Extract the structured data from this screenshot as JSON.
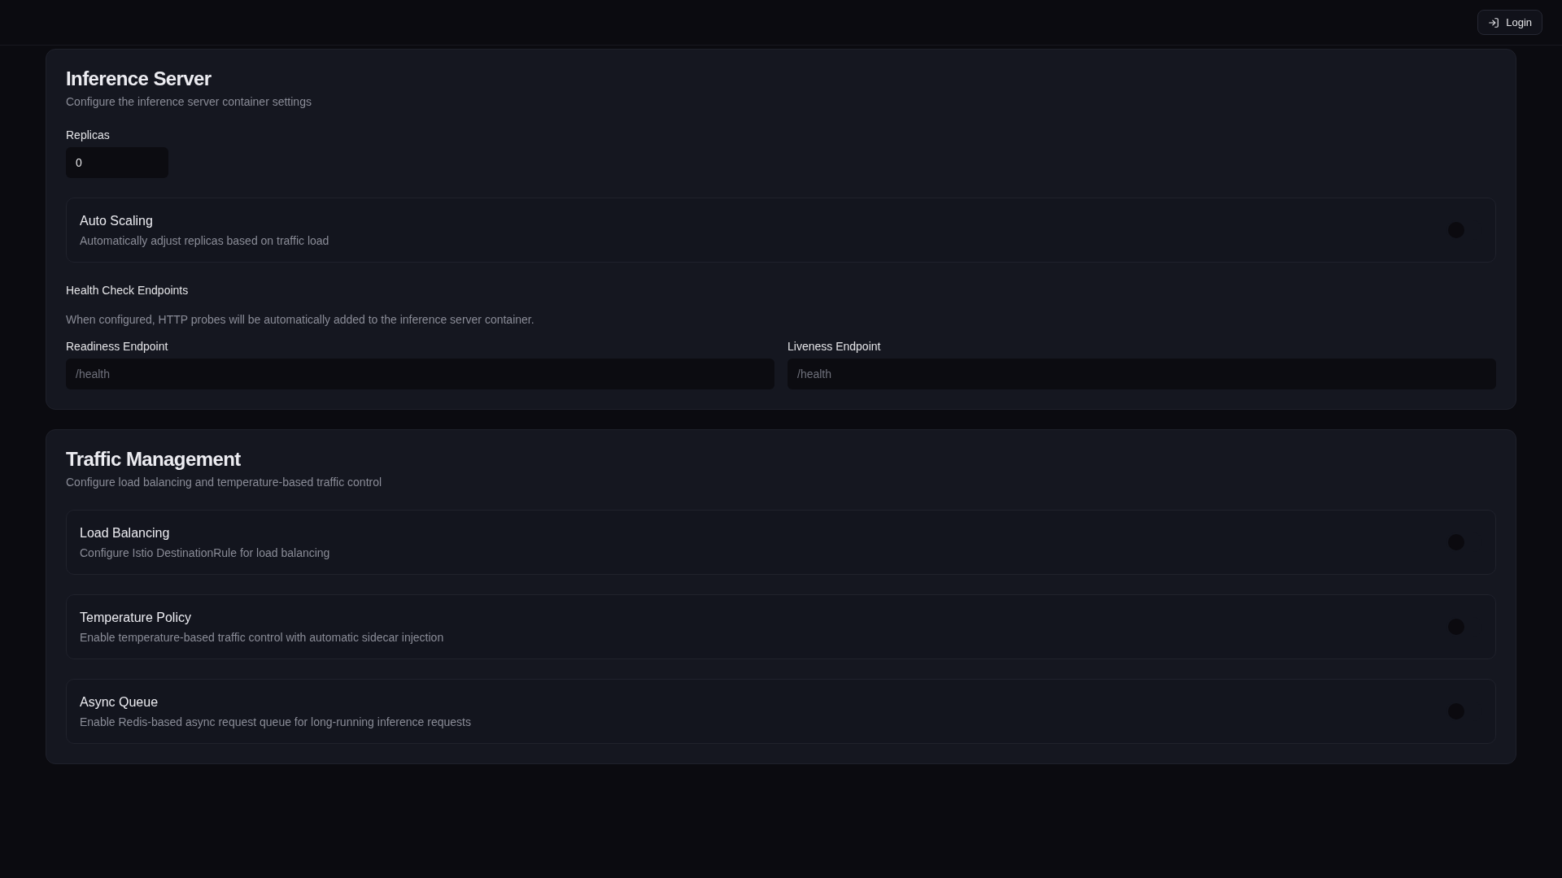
{
  "header": {
    "login_button": {
      "label": "Login"
    }
  },
  "inference_server": {
    "title": "Inference Server",
    "description": "Configure the inference server container settings",
    "replicas": {
      "label": "Replicas",
      "value": "0"
    },
    "toggles": [
      {
        "title": "Auto Scaling",
        "description": "Automatically adjust replicas based on traffic load",
        "on": false
      }
    ],
    "health_check": {
      "title": "Health Check Endpoints",
      "description": "When configured, HTTP probes will be automatically added to the inference server container.",
      "endpoints": [
        {
          "label": "Readiness Endpoint",
          "placeholder": "/health"
        },
        {
          "label": "Liveness Endpoint",
          "placeholder": "/health"
        }
      ]
    }
  },
  "traffic_management": {
    "title": "Traffic Management",
    "description": "Configure load balancing and temperature-based traffic control",
    "toggles": [
      {
        "title": "Load Balancing",
        "description": "Configure Istio DestinationRule for load balancing",
        "on": false
      },
      {
        "title": "Temperature Policy",
        "description": "Enable temperature-based traffic control with automatic sidecar injection",
        "on": false
      },
      {
        "title": "Async Queue",
        "description": "Enable Redis-based async request queue for long-running inference requests",
        "on": false
      }
    ]
  }
}
